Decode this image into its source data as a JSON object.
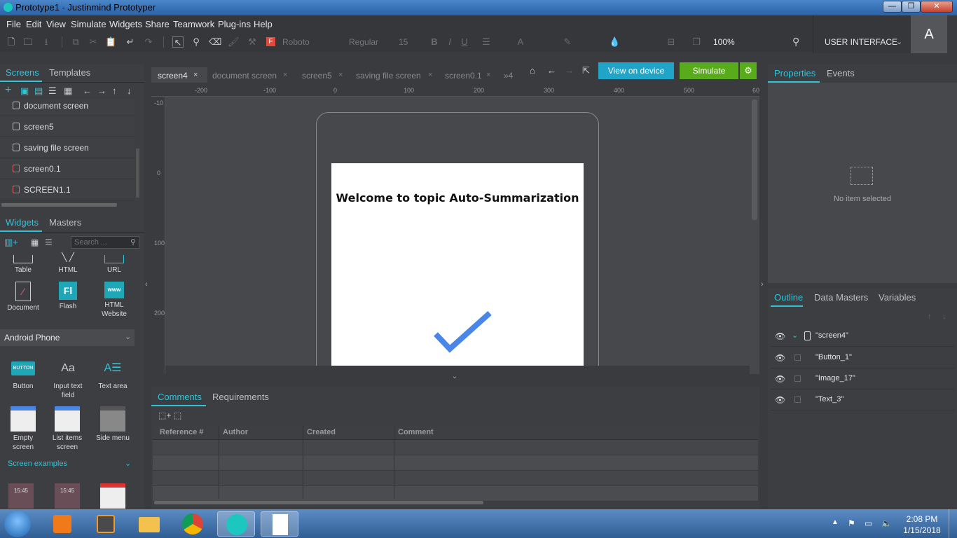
{
  "window": {
    "title": "Prototype1 - Justinmind Prototyper",
    "min": "—",
    "max": "❐",
    "close": "✕"
  },
  "menu": [
    "File",
    "Edit",
    "View",
    "Simulate",
    "Widgets",
    "Share",
    "Teamwork",
    "Plug-ins",
    "Help"
  ],
  "toolbar": {
    "font": "Roboto",
    "weight": "Regular",
    "size": "15",
    "zoom": "100%"
  },
  "header": {
    "mode": "USER INTERFACE",
    "avatar": "A"
  },
  "left": {
    "tabs": [
      "Screens",
      "Templates"
    ],
    "screens": [
      {
        "name": "document screen",
        "icon": "screen"
      },
      {
        "name": "screen5",
        "icon": "screen"
      },
      {
        "name": "saving file screen",
        "icon": "screen"
      },
      {
        "name": "screen0.1",
        "icon": "screen-red"
      },
      {
        "name": "SCREEN1.1",
        "icon": "screen-red"
      }
    ],
    "widget_tabs": [
      "Widgets",
      "Masters"
    ],
    "search_placeholder": "Search ...",
    "widgets_top": [
      "Table",
      "HTML",
      "URL"
    ],
    "widgets_mid": [
      "Document",
      "Flash",
      "HTML\nWebsite"
    ],
    "section": "Android Phone",
    "widgets_android_1": [
      "Button",
      "Input text\nfield",
      "Text area"
    ],
    "widgets_android_2": [
      "Empty\nscreen",
      "List items\nscreen",
      "Side menu"
    ],
    "examples": "Screen examples",
    "example_times": [
      "15:45",
      "15:45"
    ],
    "button_widget_label": "BUTTON",
    "input_widget_label": "Aa"
  },
  "center": {
    "tabs": [
      "screen4",
      "document screen",
      "screen5",
      "saving file screen",
      "screen0.1"
    ],
    "more": "»4",
    "view_on_device": "View on device",
    "simulate": "Simulate",
    "ruler_h": [
      "-200",
      "-100",
      "0",
      "100",
      "200",
      "300",
      "400",
      "500",
      "60"
    ],
    "ruler_v": [
      "-10",
      "0",
      "100",
      "200"
    ],
    "screen_heading": "Welcome to topic Auto-Summarization"
  },
  "bottom": {
    "tabs": [
      "Comments",
      "Requirements"
    ],
    "columns": [
      "Reference #",
      "Author",
      "Created",
      "Comment"
    ]
  },
  "right": {
    "tabs": [
      "Properties",
      "Events"
    ],
    "no_item": "No item selected",
    "outline_tabs": [
      "Outline",
      "Data Masters",
      "Variables"
    ],
    "outline": [
      "\"screen4\"",
      "\"Button_1\"",
      "\"Image_17\"",
      "\"Text_3\""
    ]
  },
  "taskbar": {
    "time": "2:08 PM",
    "date": "1/15/2018"
  },
  "colors": {
    "accent": "#2ec5d9",
    "view_btn": "#20a5c9",
    "simulate_btn": "#58ab1a",
    "check": "#4a86e8"
  }
}
